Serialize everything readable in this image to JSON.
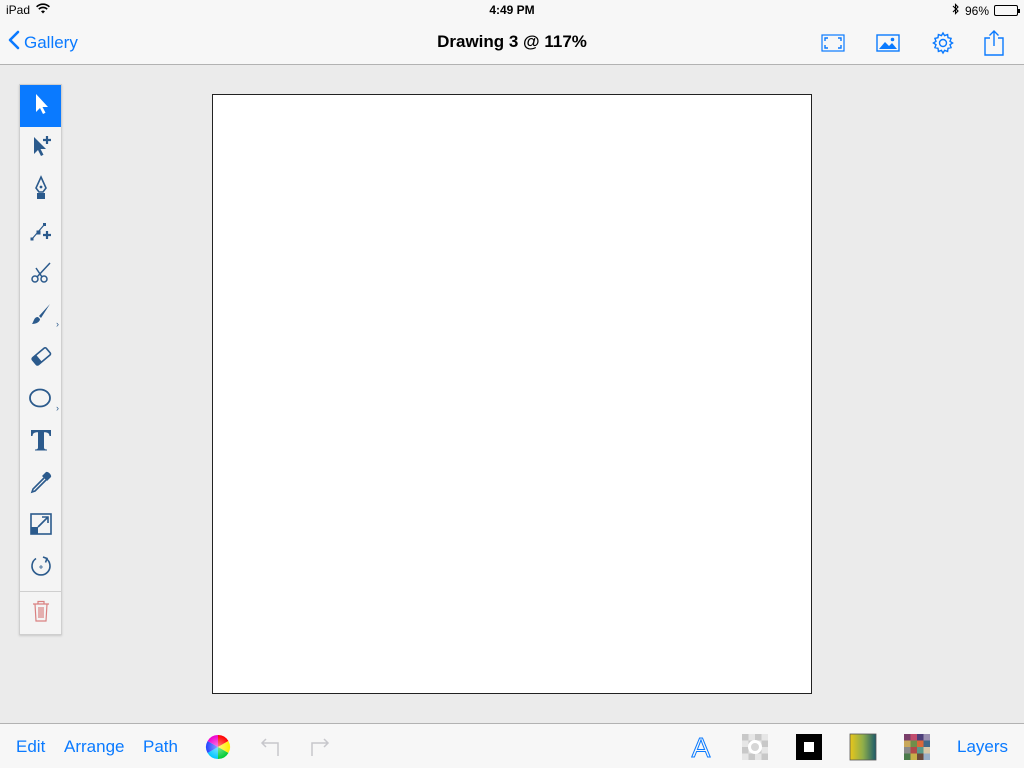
{
  "status_bar": {
    "device": "iPad",
    "time": "4:49 PM",
    "battery": "96%",
    "battery_level": 0.96
  },
  "nav_bar": {
    "back_label": "Gallery",
    "title": "Drawing 3 @ 117%",
    "icons": [
      "fullscreen-icon",
      "image-icon",
      "gear-icon",
      "share-icon"
    ]
  },
  "tools": [
    {
      "id": "select",
      "icon": "arrow-pointer-icon",
      "active": true
    },
    {
      "id": "direct-select",
      "icon": "arrow-plus-icon",
      "active": false
    },
    {
      "id": "pen",
      "icon": "pen-nib-icon",
      "active": false
    },
    {
      "id": "add-anchor",
      "icon": "anchor-plus-icon",
      "active": false
    },
    {
      "id": "scissors",
      "icon": "scissors-icon",
      "active": false
    },
    {
      "id": "brush",
      "icon": "brush-icon",
      "active": false,
      "has_submenu": true
    },
    {
      "id": "eraser",
      "icon": "eraser-icon",
      "active": false
    },
    {
      "id": "shape",
      "icon": "ellipse-icon",
      "active": false,
      "has_submenu": true
    },
    {
      "id": "text",
      "icon": "text-icon",
      "active": false
    },
    {
      "id": "eyedropper",
      "icon": "eyedropper-icon",
      "active": false
    },
    {
      "id": "scale",
      "icon": "scale-icon",
      "active": false
    },
    {
      "id": "rotate",
      "icon": "rotate-icon",
      "active": false
    },
    {
      "id": "delete",
      "icon": "trash-icon",
      "active": false
    }
  ],
  "bottom_bar": {
    "edit": "Edit",
    "arrange": "Arrange",
    "path": "Path",
    "layers": "Layers",
    "text_style_glyph": "A"
  },
  "colors": {
    "accent": "#0a7aff",
    "tool_icon": "#2b5a8c",
    "trash_icon": "#d98080",
    "canvas": "#ffffff",
    "background": "#ebebeb"
  }
}
